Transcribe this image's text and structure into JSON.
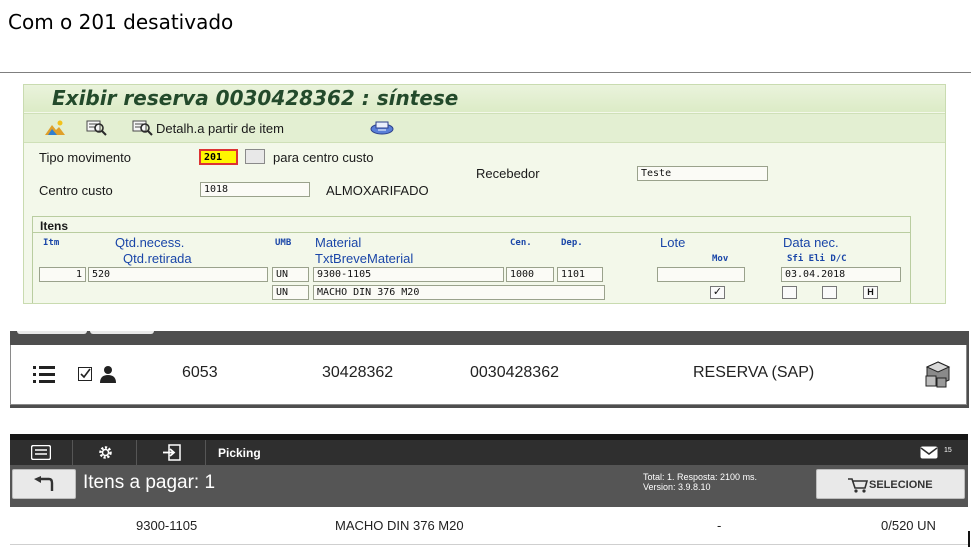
{
  "heading": "Com o 201 desativado",
  "sap": {
    "title": "Exibir reserva 0030428362 : síntese",
    "toolbar": {
      "detail_label": "Detalh.a partir de item"
    },
    "tipo_movimento": {
      "label": "Tipo movimento",
      "value": "201",
      "suffix": "para centro custo"
    },
    "recebedor": {
      "label": "Recebedor",
      "value": "Teste"
    },
    "centro_custo": {
      "label": "Centro custo",
      "value": "1018",
      "description": "ALMOXARIFADO"
    },
    "itens": {
      "title": "Itens",
      "headers": {
        "itm": "Itm",
        "qtd_necess": "Qtd.necess.",
        "umb": "UMB",
        "material": "Material",
        "cen": "Cen.",
        "dep": "Dep.",
        "lote": "Lote",
        "data_nec": "Data nec.",
        "qtd_retirada": "Qtd.retirada",
        "txt_breve": "TxtBreveMaterial",
        "mov": "Mov",
        "sfi_eli_dc": "Sfi Eli D/C"
      },
      "row": {
        "itm": "1",
        "qtd": "520",
        "umb": "UN",
        "material": "9300-1105",
        "cen": "1000",
        "dep": "1101",
        "lote": "",
        "data": "03.04.2018",
        "umb2": "UN",
        "txt": "MACHO DIN 376 M20",
        "mov_checked": "✓",
        "dc": "H"
      }
    }
  },
  "reserva_row": {
    "code": "6053",
    "number": "30428362",
    "reserva": "0030428362",
    "type": "RESERVA (SAP)"
  },
  "picking": {
    "nav_title": "Picking",
    "badge": "15",
    "title": "Itens a pagar: 1",
    "stats_line1": "Total: 1. Resposta: 2100 ms.",
    "stats_line2": "Version: 3.9.8.10",
    "select_label": "SELECIONE",
    "row": {
      "code": "9300-1105",
      "description": "MACHO DIN 376 M20",
      "dash": "-",
      "qty": "0/520 UN"
    }
  },
  "colors": {
    "sap_bg": "#f3f8ea",
    "sap_title": "#234a2b",
    "sap_header_blue": "#1a46a8",
    "highlight_yellow": "#fff700",
    "app_dark": "#2f2f2f",
    "app_gray": "#555555"
  },
  "icons": [
    "mountain-icon",
    "search-icon",
    "search-detail-icon",
    "printer-icon",
    "list-icon",
    "check-icon",
    "person-icon",
    "boxes-icon",
    "message-icon",
    "gear-icon",
    "login-icon",
    "back-arrow-icon",
    "cart-icon"
  ]
}
